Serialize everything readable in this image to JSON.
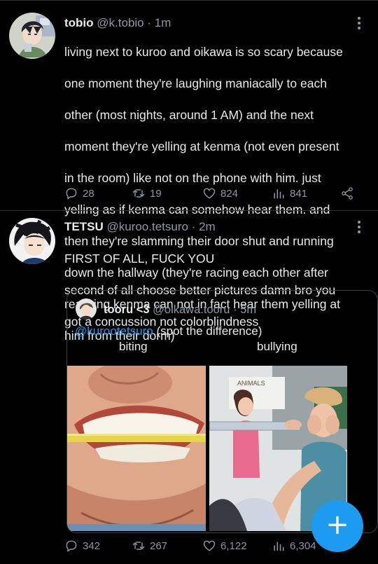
{
  "tweets": [
    {
      "display_name": "tobio",
      "handle": "@k.tobio",
      "time": "· 1m",
      "text_lines": [
        "living next to kuroo and oikawa is so scary because",
        "one moment they're laughing maniacally to each",
        "other (most nights, around 1 AM) and the next",
        "moment they're yelling at kenma (not even present",
        "in the room) like not on the phone with him. just",
        "yelling as if kenma can somehow hear them. and",
        "then they're slamming their door shut and running",
        "down the hallway (they're racing each other after",
        "realizing kenma can not in fact hear them yelling at",
        "him from their dorm)"
      ],
      "replies": "28",
      "retweets": "19",
      "likes": "824",
      "views": "841",
      "avatar_icon": "anime-boy-avatar"
    },
    {
      "display_name": "TETSU",
      "handle": "@kuroo.tetsuro",
      "time": "· 2m",
      "text_lines": [
        "FIRST OF ALL, FUCK YOU",
        "second of all choose better pictures damn bro you",
        "got a concussion not colorblindness"
      ],
      "avatar_icon": "anime-boy-avatar",
      "quoted": {
        "display_name": "tooru <3",
        "handle": "@oikawa.tooru",
        "time": "· 5m",
        "mention": "@kurootetsuro",
        "text": " (spot the difference)",
        "label_left": "biting",
        "label_right": "bullying",
        "image_left": "photo-teeth-biting-pencil",
        "image_right": "photo-children-bullying",
        "image_right_sign": "ANIMALS"
      },
      "replies": "342",
      "retweets": "267",
      "likes": "6,122",
      "views": "6,304"
    }
  ],
  "fab": {
    "label": "+",
    "icon": "compose-plus-icon"
  },
  "colors": {
    "accent": "#1d9bf0",
    "muted": "#8b98a5",
    "background": "#000000",
    "divider": "#2f3336"
  }
}
